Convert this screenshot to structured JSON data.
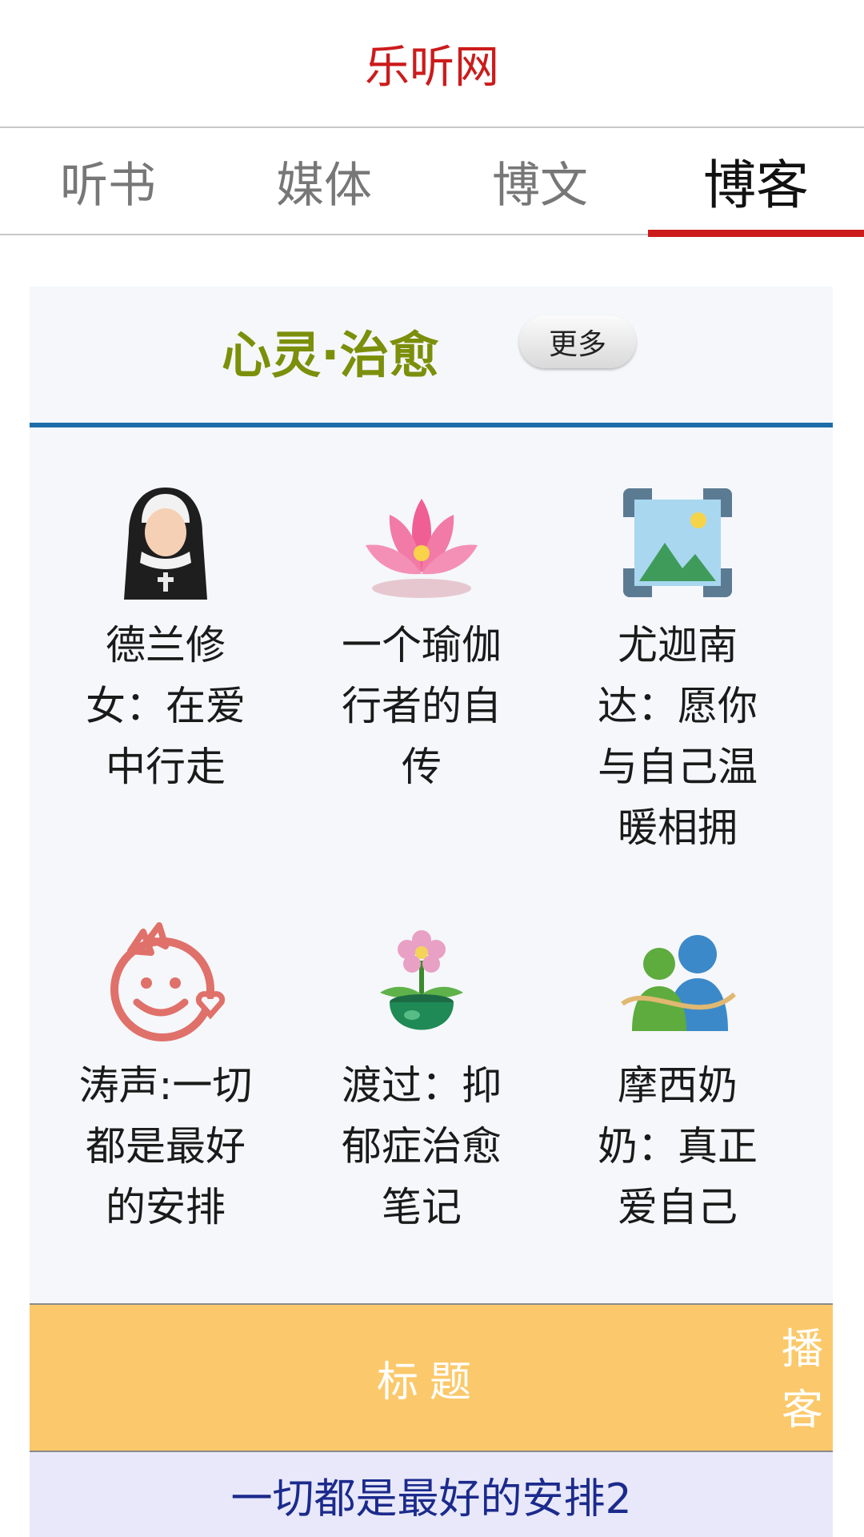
{
  "site": {
    "title": "乐听网"
  },
  "tabs": [
    {
      "label": "听书",
      "active": false
    },
    {
      "label": "媒体",
      "active": false
    },
    {
      "label": "博文",
      "active": false
    },
    {
      "label": "博客",
      "active": true
    }
  ],
  "section": {
    "title": "心灵·治愈",
    "more_label": "更多",
    "items": [
      {
        "label": "德兰修女：在爱中行走",
        "icon": "nun-icon"
      },
      {
        "label": "一个瑜伽行者的自传",
        "icon": "lotus-icon"
      },
      {
        "label": "尤迦南达：愿你与自己温暖相拥",
        "icon": "image-placeholder-icon"
      },
      {
        "label": "涛声:一切都是最好的安排",
        "icon": "smiley-girl-icon"
      },
      {
        "label": "渡过：抑郁症治愈笔记",
        "icon": "potted-flower-icon"
      },
      {
        "label": "摩西奶奶：真正爱自己",
        "icon": "contacts-icon"
      }
    ]
  },
  "table": {
    "header_title": "标题",
    "header_podcast": "播客",
    "rows": [
      {
        "title": "一切都是最好的安排2"
      }
    ]
  },
  "colors": {
    "brand_red": "#cc1b1b",
    "section_title": "#7c8f0a",
    "section_rule": "#1d6da9",
    "table_header": "#fbc96b",
    "row_bg": "#e8e8fa",
    "link": "#1b2a8c"
  }
}
